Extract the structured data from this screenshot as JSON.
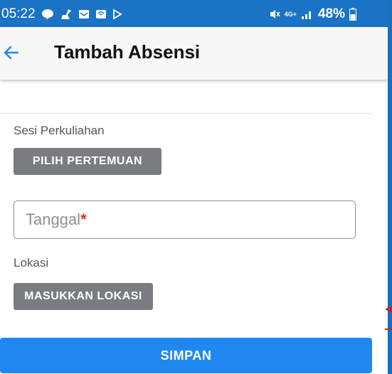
{
  "status_bar": {
    "time": "05:22",
    "network": "4G+",
    "battery_percent": "48%",
    "icons": [
      "line-chat-icon",
      "cleaner-icon",
      "mail-icon",
      "cast-icon",
      "play-icon",
      "mute-icon",
      "network-icon",
      "signal-icon",
      "battery-icon"
    ]
  },
  "app_bar": {
    "back_icon": "arrow-left-icon",
    "title": "Tambah Absensi"
  },
  "form": {
    "session_label": "Sesi Perkuliahan",
    "choose_meeting_button": "PILIH PERTEMUAN",
    "date_placeholder": "Tanggal",
    "date_required_mark": "*",
    "location_label": "Lokasi",
    "enter_location_button": "MASUKKAN LOKASI",
    "save_button": "SIMPAN"
  },
  "colors": {
    "status_bar": "#1a73c4",
    "primary_button": "#1e88f0",
    "secondary_button": "#7b7c82",
    "back_arrow": "#1e88f0",
    "required": "#d4302a",
    "annotation_arrow": "#d02020"
  }
}
